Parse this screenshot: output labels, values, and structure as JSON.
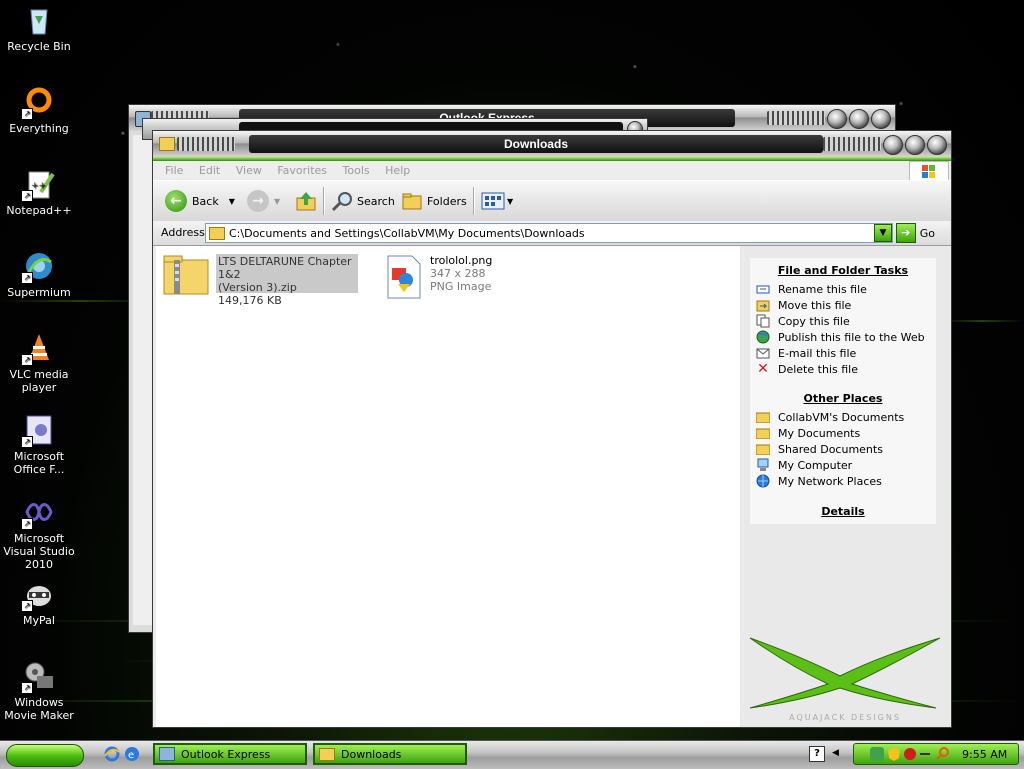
{
  "desktop": {
    "icons": [
      {
        "label": "Recycle Bin",
        "icon": "recycle-bin-icon"
      },
      {
        "label": "Everything",
        "icon": "everything-search-icon"
      },
      {
        "label": "Notepad++",
        "icon": "notepad-plus-plus-icon"
      },
      {
        "label": "Supermium",
        "icon": "supermium-browser-icon"
      },
      {
        "label": "VLC media player",
        "icon": "vlc-cone-icon"
      },
      {
        "label": "Microsoft Office F...",
        "icon": "office-document-icon"
      },
      {
        "label": "Microsoft Visual Studio 2010",
        "icon": "visual-studio-icon"
      },
      {
        "label": "MyPal",
        "icon": "mypal-raccoon-icon"
      },
      {
        "label": "Windows Movie Maker",
        "icon": "movie-maker-icon"
      }
    ]
  },
  "background_windows": {
    "outlook_title": "Outlook Express"
  },
  "explorer": {
    "title": "Downloads",
    "menu": [
      "File",
      "Edit",
      "View",
      "Favorites",
      "Tools",
      "Help"
    ],
    "toolbar": {
      "back": "Back",
      "search": "Search",
      "folders": "Folders"
    },
    "address": {
      "label": "Address",
      "path": "C:\\Documents and Settings\\CollabVM\\My Documents\\Downloads",
      "go": "Go"
    },
    "files": [
      {
        "name_line1": "LTS DELTARUNE Chapter 1&2",
        "name_line2": "(Version 3).zip",
        "detail": "149,176 KB",
        "icon": "zip-folder-icon",
        "selected": true
      },
      {
        "name_line1": "trololol.png",
        "name_line2": "347 x 288",
        "detail": "PNG Image",
        "icon": "png-image-icon",
        "selected": false
      }
    ],
    "tasks": {
      "file_folder_header": "File and Folder Tasks",
      "file_folder_items": [
        "Rename this file",
        "Move this file",
        "Copy this file",
        "Publish this file to the Web",
        "E-mail this file",
        "Delete this file"
      ],
      "other_places_header": "Other Places",
      "other_places_items": [
        "CollabVM's Documents",
        "My Documents",
        "Shared Documents",
        "My Computer",
        "My Network Places"
      ],
      "details_header": "Details"
    },
    "branding": "AQUAJACK DESIGNS"
  },
  "taskbar": {
    "tasks": [
      {
        "label": "Outlook Express"
      },
      {
        "label": "Downloads"
      }
    ],
    "clock": "9:55 AM"
  },
  "colors": {
    "accent_green": "#4fbf0f",
    "title_dark": "#111111",
    "window_gray": "#ececec"
  }
}
